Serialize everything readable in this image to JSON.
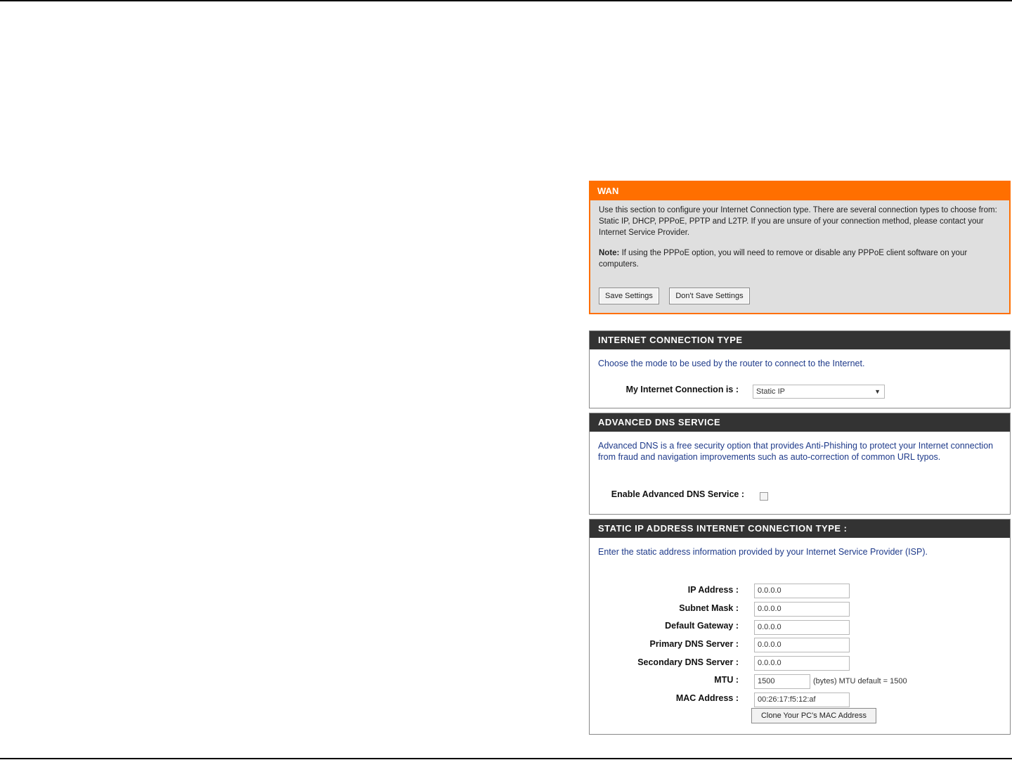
{
  "wan": {
    "title": "WAN",
    "description": "Use this section to configure your Internet Connection type. There are several connection types to choose from: Static IP, DHCP, PPPoE, PPTP and L2TP. If you are unsure of your connection method, please contact your Internet Service Provider.",
    "note_label": "Note:",
    "note_text": " If using the PPPoE option, you will need to remove or disable any PPPoE client software on your computers.",
    "save_label": "Save Settings",
    "dont_save_label": "Don't Save Settings"
  },
  "internet_connection_type": {
    "title": "INTERNET CONNECTION TYPE",
    "description": "Choose the mode to be used by the router to connect to the Internet.",
    "mode_label": "My Internet Connection is :",
    "mode_value": "Static IP"
  },
  "advanced_dns": {
    "title": "ADVANCED DNS SERVICE",
    "description": "Advanced DNS is a free security option that provides Anti-Phishing to protect your Internet connection from fraud and navigation improvements such as auto-correction of common URL typos.",
    "enable_label": "Enable Advanced DNS Service :",
    "enabled": false
  },
  "static_ip": {
    "title": "STATIC IP ADDRESS INTERNET CONNECTION TYPE :",
    "description": "Enter the static address information provided by your Internet Service Provider (ISP).",
    "fields": [
      {
        "label": "IP Address :",
        "value": "0.0.0.0"
      },
      {
        "label": "Subnet Mask :",
        "value": "0.0.0.0"
      },
      {
        "label": "Default Gateway :",
        "value": "0.0.0.0"
      },
      {
        "label": "Primary DNS Server :",
        "value": "0.0.0.0"
      },
      {
        "label": "Secondary DNS Server :",
        "value": "0.0.0.0"
      },
      {
        "label": "MTU :",
        "value": "1500"
      },
      {
        "label": "MAC Address :",
        "value": "00:26:17:f5:12:af"
      }
    ],
    "mtu_note": "(bytes) MTU default = 1500",
    "clone_label": "Clone Your PC's MAC Address"
  }
}
